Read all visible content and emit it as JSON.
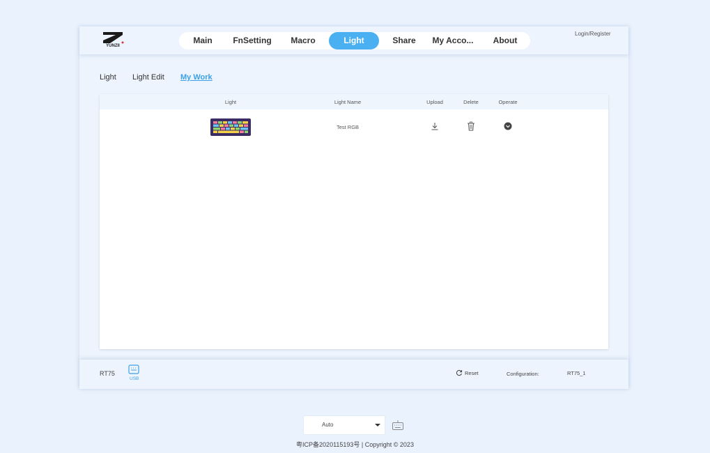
{
  "header": {
    "logo_text": "YUNZII",
    "nav": [
      {
        "label": "Main",
        "active": false
      },
      {
        "label": "FnSetting",
        "active": false
      },
      {
        "label": "Macro",
        "active": false
      },
      {
        "label": "Light",
        "active": true
      },
      {
        "label": "Share",
        "active": false
      },
      {
        "label": "My Acco...",
        "active": false
      },
      {
        "label": "About",
        "active": false
      }
    ],
    "login_label": "Login/Register"
  },
  "subtabs": [
    {
      "label": "Light",
      "active": false
    },
    {
      "label": "Light Edit",
      "active": false
    },
    {
      "label": "My Work",
      "active": true
    }
  ],
  "table": {
    "columns": [
      "Light",
      "Light Name",
      "Upload",
      "Delete",
      "Operate"
    ],
    "rows": [
      {
        "light_name": "Test RGB",
        "thumb_icon": "keyboard-thumbnail",
        "upload_icon": "download-icon",
        "delete_icon": "trash-icon",
        "operate_icon": "chevron-down-circle-icon"
      }
    ]
  },
  "footer": {
    "device_name": "RT75",
    "connection_label": "USB",
    "reset_label": "Reset",
    "configuration_label": "Configuration:",
    "configuration_value": "RT75_1"
  },
  "bottom": {
    "mode_select_value": "Auto",
    "copyright": "粤ICP备2020115193号 | Copyright © 2023"
  },
  "colors": {
    "accent": "#4ab0f2",
    "background": "#eaf2fd",
    "panel": "#edf4fd"
  }
}
